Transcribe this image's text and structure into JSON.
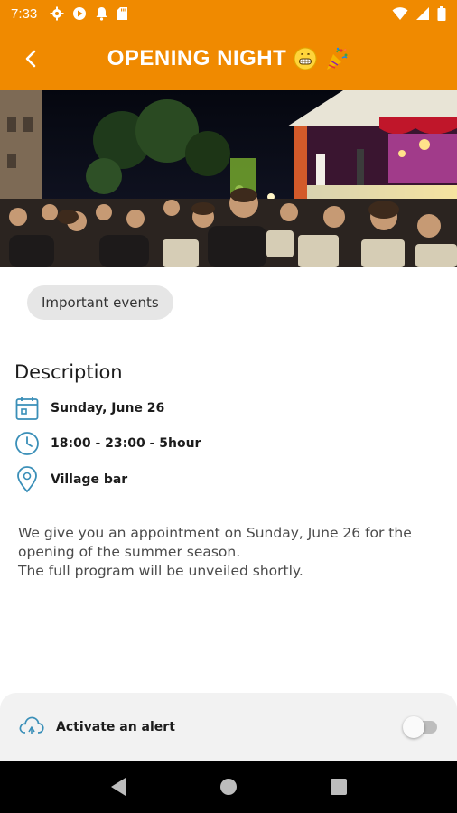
{
  "status_bar": {
    "time": "7:33",
    "left_icons": [
      "gear-icon",
      "play-store-icon",
      "bell-icon",
      "sd-card-icon"
    ],
    "right_icons": [
      "wifi-icon",
      "signal-icon",
      "battery-icon"
    ]
  },
  "app_bar": {
    "title": "OPENING NIGHT",
    "title_emojis": [
      "😁",
      "🎉"
    ],
    "back_icon": "chevron-left-icon"
  },
  "hero": {
    "subject": "outdoor evening show with seated audience in front of an illuminated stage"
  },
  "category_chip": "Important events",
  "description": {
    "heading": "Description",
    "date": "Sunday, June 26",
    "time": "18:00 - 23:00 - 5hour",
    "location": "Village bar",
    "body_line1": "We give you an appointment on Sunday, June 26 for the opening of the summer season.",
    "body_line2": "The full program will be unveiled shortly."
  },
  "alert": {
    "label": "Activate an alert",
    "enabled": false
  },
  "colors": {
    "primary": "#f08a00",
    "icon_accent": "#3a8fb8",
    "chip_bg": "#e6e6e6"
  }
}
